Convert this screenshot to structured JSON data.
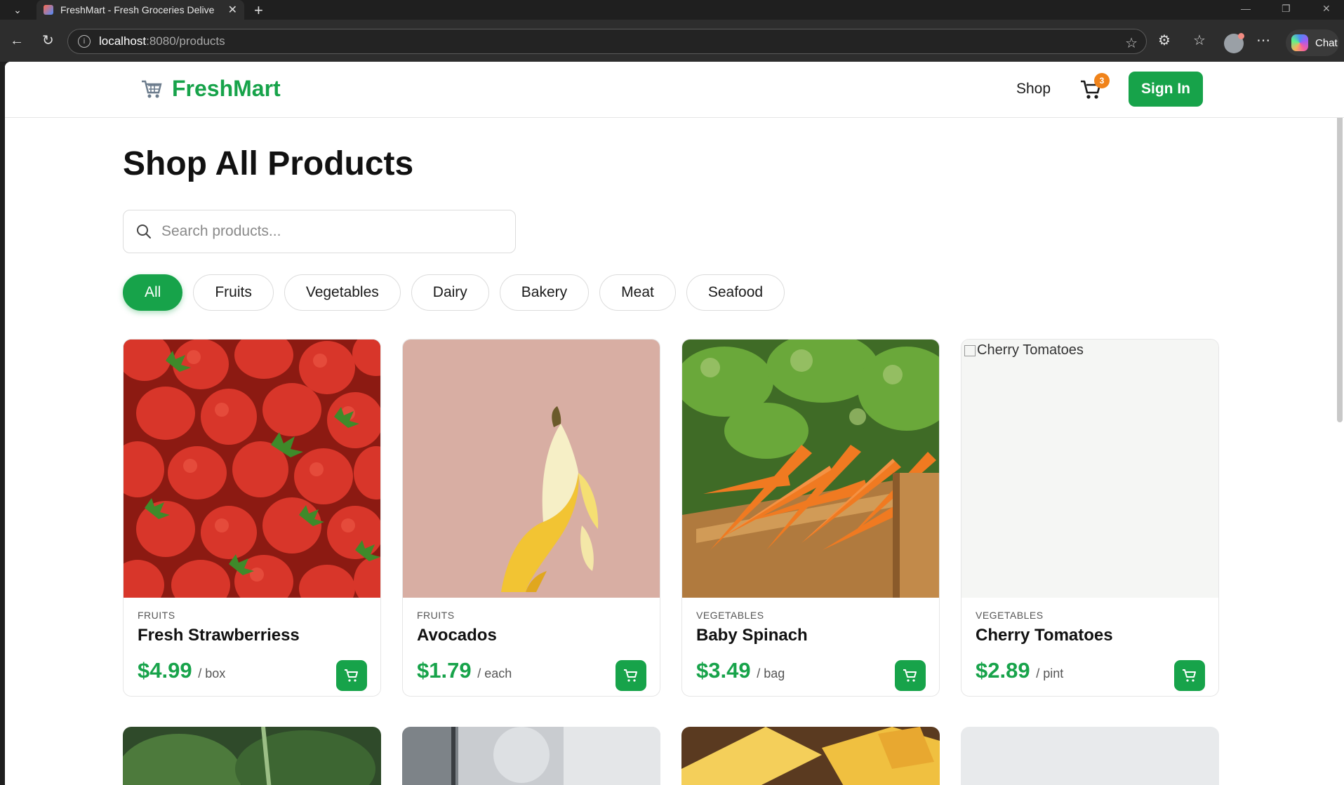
{
  "browser": {
    "tab_title": "FreshMart - Fresh Groceries Delive",
    "url_host": "localhost",
    "url_path": ":8080/products",
    "chat_label": "Chat"
  },
  "header": {
    "brand": "FreshMart",
    "nav_shop": "Shop",
    "cart_count": "3",
    "signin_label": "Sign In"
  },
  "main": {
    "title": "Shop All Products",
    "search_placeholder": "Search products...",
    "categories": [
      "All",
      "Fruits",
      "Vegetables",
      "Dairy",
      "Bakery",
      "Meat",
      "Seafood"
    ],
    "active_category": "All"
  },
  "products": [
    {
      "category": "FRUITS",
      "name": "Fresh Strawberriess",
      "price": "$4.99",
      "unit": "/ box",
      "image": "strawberries"
    },
    {
      "category": "FRUITS",
      "name": "Avocados",
      "price": "$1.79",
      "unit": "/ each",
      "image": "banana"
    },
    {
      "category": "VEGETABLES",
      "name": "Baby Spinach",
      "price": "$3.49",
      "unit": "/ bag",
      "image": "carrots"
    },
    {
      "category": "VEGETABLES",
      "name": "Cherry Tomatoes",
      "price": "$2.89",
      "unit": "/ pint",
      "image": "broken",
      "image_alt": "Cherry Tomatoes"
    }
  ],
  "colors": {
    "brand_green": "#17a34a",
    "badge_orange": "#f0831a"
  }
}
